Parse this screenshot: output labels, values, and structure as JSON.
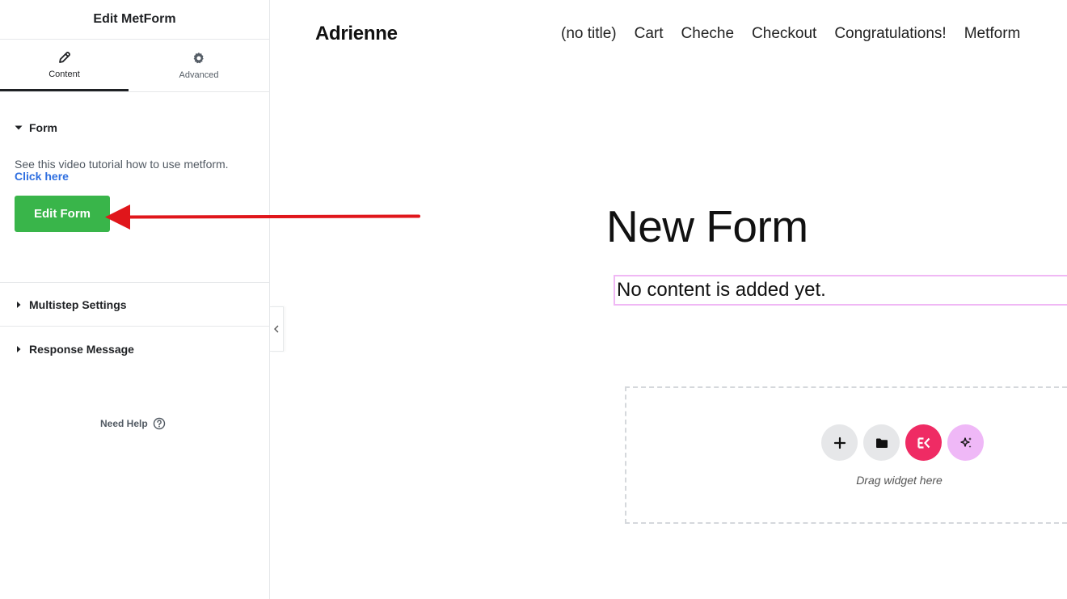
{
  "panel": {
    "title": "Edit MetForm",
    "tabs": [
      {
        "label": "Content",
        "icon": "pencil-icon",
        "active": true
      },
      {
        "label": "Advanced",
        "icon": "gear-icon",
        "active": false
      }
    ],
    "sections": {
      "form": {
        "label": "Form",
        "tutorial_text": "See this video tutorial how to use metform.",
        "tutorial_link": "Click here",
        "edit_button": "Edit Form"
      },
      "multistep": {
        "label": "Multistep Settings"
      },
      "response": {
        "label": "Response Message"
      }
    },
    "help_label": "Need Help"
  },
  "preview": {
    "site_title": "Adrienne",
    "nav": [
      "(no title)",
      "Cart",
      "Cheche",
      "Checkout",
      "Congratulations!",
      "Metform"
    ],
    "form_heading": "New Form",
    "empty_message": "No content is added yet.",
    "drop_label": "Drag widget here"
  },
  "colors": {
    "edit_button": "#39b54a",
    "link": "#2f6fe0",
    "elementor_pink": "#ef2b64",
    "ai_lilac": "#efb8f7",
    "annotation_arrow": "#e0161b"
  }
}
